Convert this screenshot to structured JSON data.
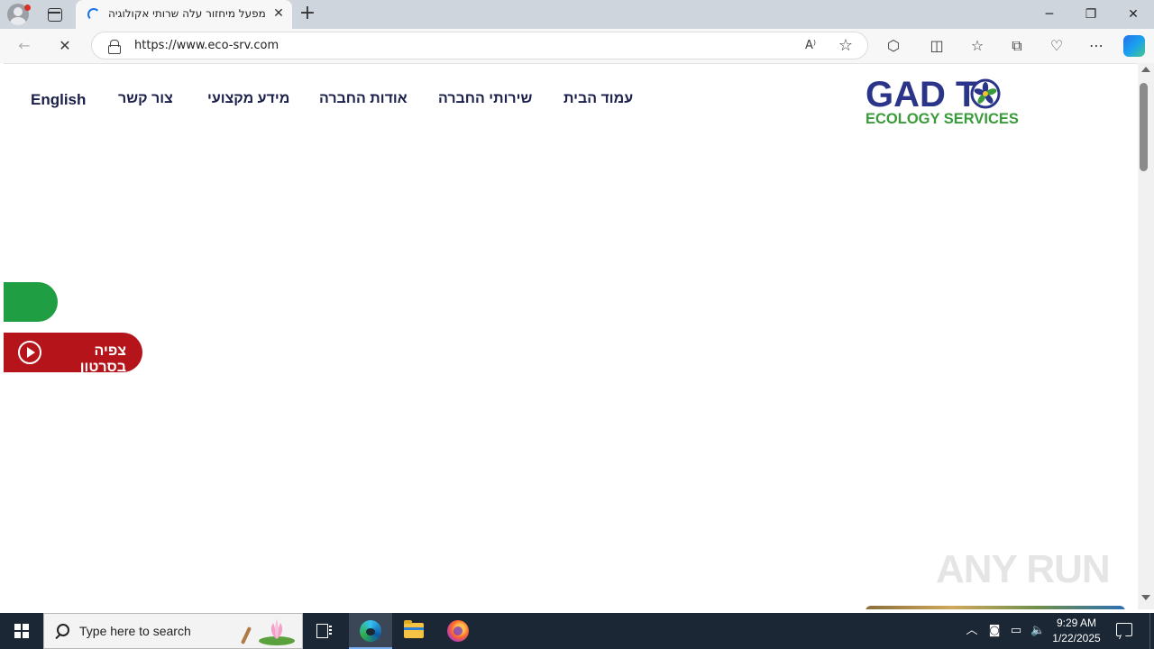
{
  "browser": {
    "tab_title": "מפעל מיחזור עלה שרותי אקולוגיה",
    "tab_close": "✕",
    "new_tab": "+",
    "url": "https://www.eco-srv.com",
    "window_controls": {
      "minimize": "─",
      "restore": "❐",
      "close": "✕"
    },
    "toolbar_icons": [
      "back-icon",
      "stop-loading-icon",
      "read-aloud-icon",
      "favorite-star-icon",
      "extensions-icon",
      "split-screen-icon",
      "favorites-icon",
      "collections-icon",
      "browser-essentials-icon",
      "more-options-icon",
      "copilot-icon"
    ]
  },
  "site": {
    "nav": {
      "home": "עמוד הבית",
      "services": "שירותי החברה",
      "about": "אודות החברה",
      "info": "מידע מקצועי",
      "contact": "צור קשר",
      "english": "English"
    },
    "logo": {
      "top": "GAD T",
      "bottom": "ECOLOGY SERVICES"
    },
    "video_button": "צפיה בסרטון",
    "colors": {
      "nav_text": "#1a1f4a",
      "logo_blue": "#2a3589",
      "logo_green": "#3a9b3a",
      "green_pill": "#1f9e44",
      "video_red": "#b4141a"
    }
  },
  "watermark": "ANY RUN",
  "taskbar": {
    "search_placeholder": "Type here to search",
    "time": "9:29 AM",
    "date": "1/22/2025",
    "apps": [
      "task-view-icon",
      "edge-icon",
      "file-explorer-icon",
      "firefox-icon"
    ],
    "tray": [
      "chevron-up-icon",
      "meet-now-icon",
      "network-icon",
      "volume-icon"
    ]
  }
}
